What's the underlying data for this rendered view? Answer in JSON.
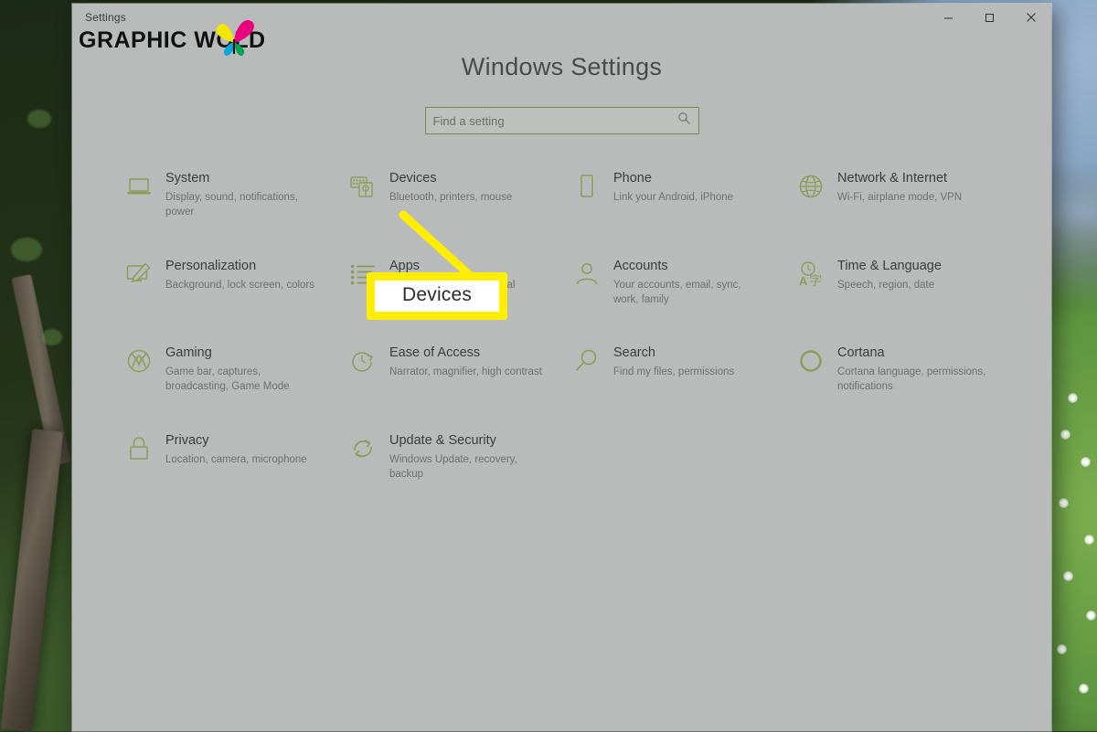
{
  "window": {
    "title": "Settings",
    "controls": [
      {
        "name": "minimize",
        "label": "Minimize"
      },
      {
        "name": "maximize",
        "label": "Maximize"
      },
      {
        "name": "close",
        "label": "Close"
      }
    ]
  },
  "watermark": {
    "text_before": "GRAPHIC WO",
    "text_after": "LD",
    "icon": "butterfly-logo"
  },
  "page": {
    "title": "Windows Settings"
  },
  "search": {
    "placeholder": "Find a setting",
    "value": "",
    "icon": "search-icon"
  },
  "colors": {
    "window_bg": "#b9bbbb",
    "accent_green": "#7e8a52",
    "icon_green": "#8d9b57",
    "callout_yellow": "#ffee00",
    "title_text": "#4a4a4a"
  },
  "tiles": [
    {
      "id": "system",
      "label": "System",
      "desc": "Display, sound, notifications, power",
      "icon": "laptop-icon"
    },
    {
      "id": "devices",
      "label": "Devices",
      "desc": "Bluetooth, printers, mouse",
      "icon": "keyboard-mouse-icon"
    },
    {
      "id": "phone",
      "label": "Phone",
      "desc": "Link your Android, iPhone",
      "icon": "phone-icon"
    },
    {
      "id": "network",
      "label": "Network & Internet",
      "desc": "Wi-Fi, airplane mode, VPN",
      "icon": "globe-icon"
    },
    {
      "id": "personalization",
      "label": "Personalization",
      "desc": "Background, lock screen, colors",
      "icon": "paintbrush-monitor-icon"
    },
    {
      "id": "apps",
      "label": "Apps",
      "desc": "Uninstall, defaults, optional features",
      "icon": "list-icon"
    },
    {
      "id": "accounts",
      "label": "Accounts",
      "desc": "Your accounts, email, sync, work, family",
      "icon": "person-icon"
    },
    {
      "id": "time-language",
      "label": "Time & Language",
      "desc": "Speech, region, date",
      "icon": "clock-language-icon"
    },
    {
      "id": "gaming",
      "label": "Gaming",
      "desc": "Game bar, captures, broadcasting, Game Mode",
      "icon": "xbox-icon"
    },
    {
      "id": "ease-of-access",
      "label": "Ease of Access",
      "desc": "Narrator, magnifier, high contrast",
      "icon": "clock-arrow-icon"
    },
    {
      "id": "search",
      "label": "Search",
      "desc": "Find my files, permissions",
      "icon": "magnifier-icon"
    },
    {
      "id": "cortana",
      "label": "Cortana",
      "desc": "Cortana language, permissions, notifications",
      "icon": "cortana-ring-icon"
    },
    {
      "id": "privacy",
      "label": "Privacy",
      "desc": "Location, camera, microphone",
      "icon": "lock-icon"
    },
    {
      "id": "update-security",
      "label": "Update & Security",
      "desc": "Windows Update, recovery, backup",
      "icon": "refresh-icon"
    }
  ],
  "annotation": {
    "label": "Devices",
    "points_to": "devices"
  }
}
